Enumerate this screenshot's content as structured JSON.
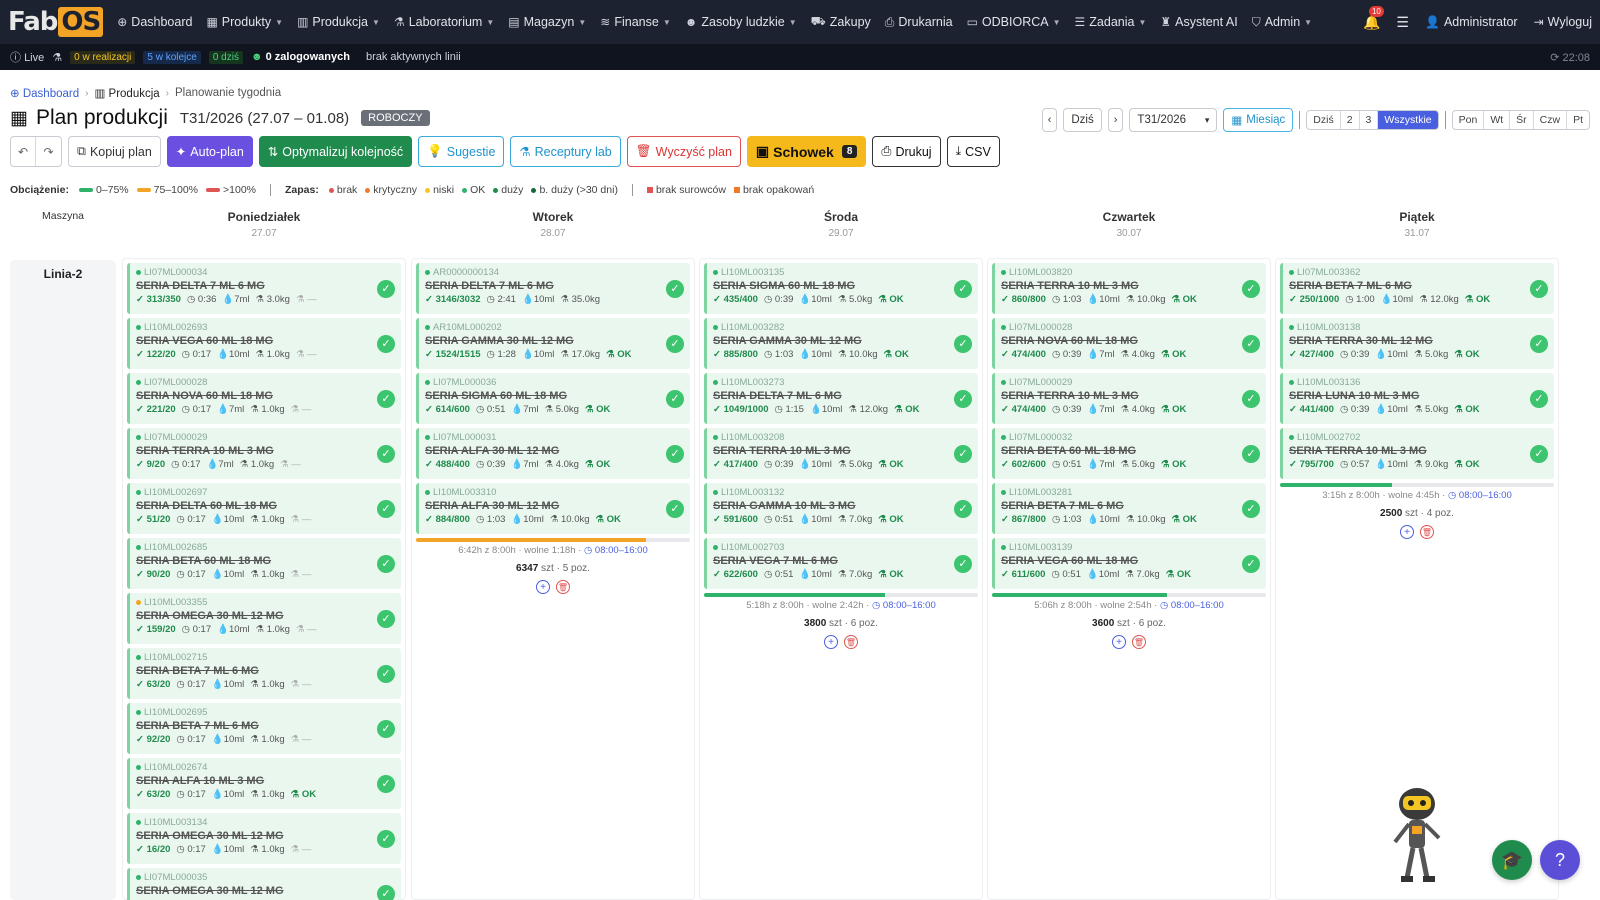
{
  "nav": {
    "items": [
      {
        "icon": "dashboard-icon",
        "glyph": "⊕",
        "label": "Dashboard",
        "caret": false
      },
      {
        "icon": "products-icon",
        "glyph": "▦",
        "label": "Produkty",
        "caret": true
      },
      {
        "icon": "factory-icon",
        "glyph": "▥",
        "label": "Produkcja",
        "caret": true
      },
      {
        "icon": "lab-icon",
        "glyph": "⚗",
        "label": "Laboratorium",
        "caret": true
      },
      {
        "icon": "warehouse-icon",
        "glyph": "▤",
        "label": "Magazyn",
        "caret": true
      },
      {
        "icon": "finance-icon",
        "glyph": "≋",
        "label": "Finanse",
        "caret": true
      },
      {
        "icon": "people-icon",
        "glyph": "☻",
        "label": "Zasoby ludzkie",
        "caret": true
      },
      {
        "icon": "truck-icon",
        "glyph": "⛟",
        "label": "Zakupy",
        "caret": false
      },
      {
        "icon": "printer-icon",
        "glyph": "⎙",
        "label": "Drukarnia",
        "caret": false
      },
      {
        "icon": "customer-icon",
        "glyph": "▭",
        "label": "ODBIORCA",
        "caret": true
      },
      {
        "icon": "tasks-icon",
        "glyph": "☰",
        "label": "Zadania",
        "caret": true
      },
      {
        "icon": "robot-icon",
        "glyph": "♜",
        "label": "Asystent AI",
        "caret": false
      },
      {
        "icon": "shield-icon",
        "glyph": "⛉",
        "label": "Admin",
        "caret": true
      }
    ],
    "notifications": "10",
    "user": "Administrator",
    "logout": "Wyloguj"
  },
  "status": {
    "live": "Live",
    "in_progress": "0 w realizacji",
    "queued": "5 w kolejce",
    "today": "0 dziś",
    "logged_in": "0 zalogowanych",
    "lines": "brak aktywnych linii",
    "time": "22:08"
  },
  "breadcrumb": {
    "home": "Dashboard",
    "section": "Produkcja",
    "current": "Planowanie tygodnia"
  },
  "page": {
    "title": "Plan produkcji",
    "week": "T31/2026 (27.07 – 01.08)",
    "badge": "ROBOCZY"
  },
  "controls": {
    "today": "Dziś",
    "week_select": "T31/2026",
    "month": "Miesiąc",
    "shift_seg": [
      "Dziś",
      "2",
      "3",
      "Wszystkie"
    ],
    "shift_active": 3,
    "days_seg": [
      "Pon",
      "Wt",
      "Śr",
      "Czw",
      "Pt"
    ]
  },
  "toolbar": {
    "copy": "Kopiuj plan",
    "autoplan": "Auto-plan",
    "optimize": "Optymalizuj kolejność",
    "suggestions": "Sugestie",
    "recipes": "Receptury lab",
    "clear": "Wyczyść plan",
    "clipboard": "Schowek",
    "clipboard_count": "8",
    "print": "Drukuj",
    "csv": "CSV"
  },
  "legend": {
    "load_label": "Obciążenie:",
    "load": [
      {
        "label": "0–75%",
        "color": "#2db36a"
      },
      {
        "label": "75–100%",
        "color": "#f3a325"
      },
      {
        "label": ">100%",
        "color": "#e05454"
      }
    ],
    "stock_label": "Zapas:",
    "stock": [
      {
        "label": "brak",
        "color": "#e05454"
      },
      {
        "label": "krytyczny",
        "color": "#f07a2a"
      },
      {
        "label": "niski",
        "color": "#f3c623"
      },
      {
        "label": "OK",
        "color": "#2db36a"
      },
      {
        "label": "duży",
        "color": "#1f8b4c"
      },
      {
        "label": "b. duży (>30 dni)",
        "color": "#17693a"
      }
    ],
    "missing": [
      {
        "label": "brak surowców",
        "color": "#e05454"
      },
      {
        "label": "brak opakowań",
        "color": "#f07a2a"
      }
    ]
  },
  "grid": {
    "machine_header": "Maszyna",
    "machine": "Linia-2",
    "days": [
      {
        "name": "Poniedziałek",
        "date": "27.07",
        "cards": [
          {
            "code": "LI07ML000034",
            "prod": "SERIA DELTA 7 ML 6 MG",
            "qty": "313/350",
            "time": "0:36",
            "vol": "7ml",
            "wt": "3.0kg",
            "stock": "—"
          },
          {
            "code": "LI10ML002693",
            "prod": "SERIA VEGA 60 ML 18 MG",
            "qty": "122/20",
            "time": "0:17",
            "vol": "10ml",
            "wt": "1.0kg",
            "stock": "—"
          },
          {
            "code": "LI07ML000028",
            "prod": "SERIA NOVA 60 ML 18 MG",
            "qty": "221/20",
            "time": "0:17",
            "vol": "7ml",
            "wt": "1.0kg",
            "stock": "—"
          },
          {
            "code": "LI07ML000029",
            "prod": "SERIA TERRA 10 ML 3 MG",
            "qty": "9/20",
            "time": "0:17",
            "vol": "7ml",
            "wt": "1.0kg",
            "stock": "—"
          },
          {
            "code": "LI10ML002697",
            "prod": "SERIA DELTA 60 ML 18 MG",
            "qty": "51/20",
            "time": "0:17",
            "vol": "10ml",
            "wt": "1.0kg",
            "stock": "—"
          },
          {
            "code": "LI10ML002685",
            "prod": "SERIA BETA 60 ML 18 MG",
            "qty": "90/20",
            "time": "0:17",
            "vol": "10ml",
            "wt": "1.0kg",
            "stock": "—"
          },
          {
            "code": "LI10ML003355",
            "prod": "SERIA OMEGA 30 ML 12 MG",
            "qty": "159/20",
            "time": "0:17",
            "vol": "10ml",
            "wt": "1.0kg",
            "stock": "—",
            "dot": "orange"
          },
          {
            "code": "LI10ML002715",
            "prod": "SERIA BETA 7 ML 6 MG",
            "qty": "63/20",
            "time": "0:17",
            "vol": "10ml",
            "wt": "1.0kg",
            "stock": "—"
          },
          {
            "code": "LI10ML002695",
            "prod": "SERIA BETA 7 ML 6 MG",
            "qty": "92/20",
            "time": "0:17",
            "vol": "10ml",
            "wt": "1.0kg",
            "stock": "—"
          },
          {
            "code": "LI10ML002674",
            "prod": "SERIA ALFA 10 ML 3 MG",
            "qty": "63/20",
            "time": "0:17",
            "vol": "10ml",
            "wt": "1.0kg",
            "stock": "OK"
          },
          {
            "code": "LI10ML003134",
            "prod": "SERIA OMEGA 30 ML 12 MG",
            "qty": "16/20",
            "time": "0:17",
            "vol": "10ml",
            "wt": "1.0kg",
            "stock": "—"
          },
          {
            "code": "LI07ML000035",
            "prod": "SERIA OMEGA 30 ML 12 MG",
            "qty": "",
            "time": "",
            "vol": "",
            "wt": "",
            "stock": ""
          }
        ]
      },
      {
        "name": "Wtorek",
        "date": "28.07",
        "cards": [
          {
            "code": "AR0000000134",
            "prod": "SERIA DELTA 7 ML 6 MG",
            "qty": "3146/3032",
            "time": "2:41",
            "vol": "10ml",
            "wt": "35.0kg",
            "stock": ""
          },
          {
            "code": "AR10ML000202",
            "prod": "SERIA GAMMA 30 ML 12 MG",
            "qty": "1524/1515",
            "time": "1:28",
            "vol": "10ml",
            "wt": "17.0kg",
            "stock": "OK"
          },
          {
            "code": "LI07ML000036",
            "prod": "SERIA SIGMA 60 ML 18 MG",
            "qty": "614/600",
            "time": "0:51",
            "vol": "7ml",
            "wt": "5.0kg",
            "stock": "OK"
          },
          {
            "code": "LI07ML000031",
            "prod": "SERIA ALFA 30 ML 12 MG",
            "qty": "488/400",
            "time": "0:39",
            "vol": "7ml",
            "wt": "4.0kg",
            "stock": "OK"
          },
          {
            "code": "LI10ML003310",
            "prod": "SERIA ALFA 30 ML 12 MG",
            "qty": "884/800",
            "time": "1:03",
            "vol": "10ml",
            "wt": "10.0kg",
            "stock": "OK"
          }
        ],
        "load": 0.84,
        "load_color": "orange",
        "foot": "6:42h z 8:00h · wolne 1:18h",
        "hours": "08:00–16:00",
        "total": "6347",
        "unit": "szt",
        "positions": "5 poz."
      },
      {
        "name": "Środa",
        "date": "29.07",
        "cards": [
          {
            "code": "LI10ML003135",
            "prod": "SERIA SIGMA 60 ML 18 MG",
            "qty": "435/400",
            "time": "0:39",
            "vol": "10ml",
            "wt": "5.0kg",
            "stock": "OK"
          },
          {
            "code": "LI10ML003282",
            "prod": "SERIA GAMMA 30 ML 12 MG",
            "qty": "885/800",
            "time": "1:03",
            "vol": "10ml",
            "wt": "10.0kg",
            "stock": "OK"
          },
          {
            "code": "LI10ML003273",
            "prod": "SERIA DELTA 7 ML 6 MG",
            "qty": "1049/1000",
            "time": "1:15",
            "vol": "10ml",
            "wt": "12.0kg",
            "stock": "OK"
          },
          {
            "code": "LI10ML003208",
            "prod": "SERIA TERRA 10 ML 3 MG",
            "qty": "417/400",
            "time": "0:39",
            "vol": "10ml",
            "wt": "5.0kg",
            "stock": "OK"
          },
          {
            "code": "LI10ML003132",
            "prod": "SERIA GAMMA 10 ML 3 MG",
            "qty": "591/600",
            "time": "0:51",
            "vol": "10ml",
            "wt": "7.0kg",
            "stock": "OK"
          },
          {
            "code": "LI10ML002703",
            "prod": "SERIA VEGA 7 ML 6 MG",
            "qty": "622/600",
            "time": "0:51",
            "vol": "10ml",
            "wt": "7.0kg",
            "stock": "OK"
          }
        ],
        "load": 0.66,
        "load_color": "green",
        "foot": "5:18h z 8:00h · wolne 2:42h",
        "hours": "08:00–16:00",
        "total": "3800",
        "unit": "szt",
        "positions": "6 poz."
      },
      {
        "name": "Czwartek",
        "date": "30.07",
        "cards": [
          {
            "code": "LI10ML003820",
            "prod": "SERIA TERRA 10 ML 3 MG",
            "qty": "860/800",
            "time": "1:03",
            "vol": "10ml",
            "wt": "10.0kg",
            "stock": "OK"
          },
          {
            "code": "LI07ML000028",
            "prod": "SERIA NOVA 60 ML 18 MG",
            "qty": "474/400",
            "time": "0:39",
            "vol": "7ml",
            "wt": "4.0kg",
            "stock": "OK"
          },
          {
            "code": "LI07ML000029",
            "prod": "SERIA TERRA 10 ML 3 MG",
            "qty": "474/400",
            "time": "0:39",
            "vol": "7ml",
            "wt": "4.0kg",
            "stock": "OK"
          },
          {
            "code": "LI07ML000032",
            "prod": "SERIA BETA 60 ML 18 MG",
            "qty": "602/600",
            "time": "0:51",
            "vol": "7ml",
            "wt": "5.0kg",
            "stock": "OK"
          },
          {
            "code": "LI10ML003281",
            "prod": "SERIA BETA 7 ML 6 MG",
            "qty": "867/800",
            "time": "1:03",
            "vol": "10ml",
            "wt": "10.0kg",
            "stock": "OK"
          },
          {
            "code": "LI10ML003139",
            "prod": "SERIA VEGA 60 ML 18 MG",
            "qty": "611/600",
            "time": "0:51",
            "vol": "10ml",
            "wt": "7.0kg",
            "stock": "OK"
          }
        ],
        "load": 0.64,
        "load_color": "green",
        "foot": "5:06h z 8:00h · wolne 2:54h",
        "hours": "08:00–16:00",
        "total": "3600",
        "unit": "szt",
        "positions": "6 poz."
      },
      {
        "name": "Piątek",
        "date": "31.07",
        "cards": [
          {
            "code": "LI07ML003362",
            "prod": "SERIA BETA 7 ML 6 MG",
            "qty": "250/1000",
            "time": "1:00",
            "vol": "10ml",
            "wt": "12.0kg",
            "stock": "OK"
          },
          {
            "code": "LI10ML003138",
            "prod": "SERIA TERRA 30 ML 12 MG",
            "qty": "427/400",
            "time": "0:39",
            "vol": "10ml",
            "wt": "5.0kg",
            "stock": "OK"
          },
          {
            "code": "LI10ML003136",
            "prod": "SERIA LUNA 10 ML 3 MG",
            "qty": "441/400",
            "time": "0:39",
            "vol": "10ml",
            "wt": "5.0kg",
            "stock": "OK"
          },
          {
            "code": "LI10ML002702",
            "prod": "SERIA TERRA 10 ML 3 MG",
            "qty": "795/700",
            "time": "0:57",
            "vol": "10ml",
            "wt": "9.0kg",
            "stock": "OK"
          }
        ],
        "load": 0.41,
        "load_color": "green",
        "foot": "3:15h z 8:00h · wolne 4:45h",
        "hours": "08:00–16:00",
        "total": "2500",
        "unit": "szt",
        "positions": "4 poz."
      }
    ]
  }
}
